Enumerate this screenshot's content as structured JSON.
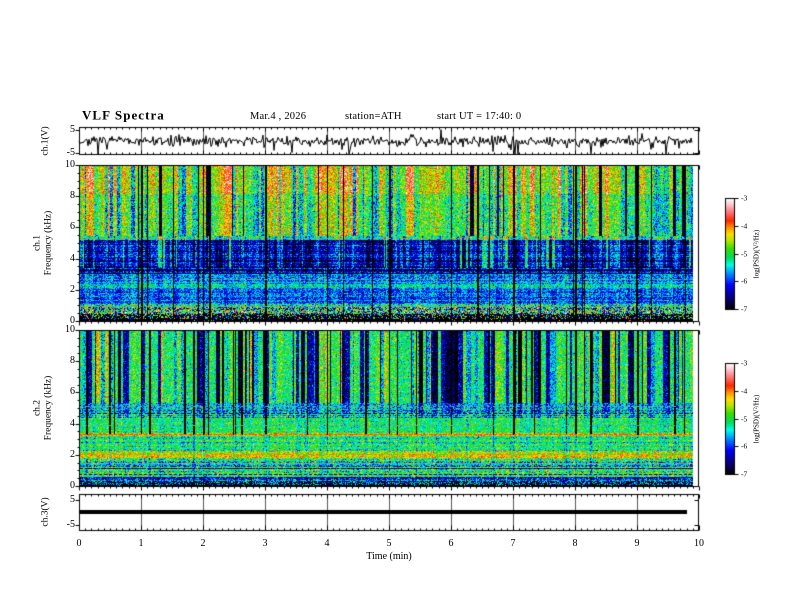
{
  "header": {
    "title": "VLF Spectra",
    "date": "Mar.4 , 2026",
    "station": "station=ATH",
    "start_ut": "start UT =  17:40: 0"
  },
  "axes": {
    "time": {
      "label": "Time (min)",
      "ticks": [
        "0",
        "1",
        "2",
        "3",
        "4",
        "5",
        "6",
        "7",
        "8",
        "9",
        "10"
      ],
      "range_min": [
        0,
        10
      ],
      "minor_tick_min": 0.1
    },
    "ch1_wave": {
      "label": "ch.1(V)",
      "ticks": [
        "5",
        "-5"
      ],
      "range_v": [
        -5,
        5
      ]
    },
    "spec1": {
      "label_line1": "ch.1",
      "label_line2": "Frequency (kHz)",
      "ticks": [
        "0",
        "2",
        "4",
        "6",
        "8",
        "10"
      ],
      "range_khz": [
        0,
        10
      ]
    },
    "spec2": {
      "label_line1": "ch.2",
      "label_line2": "Frequency (kHz)",
      "ticks": [
        "0",
        "2",
        "4",
        "6",
        "8",
        "10"
      ],
      "range_khz": [
        0,
        10
      ]
    },
    "ch3_wave": {
      "label": "ch.3(V)",
      "ticks": [
        "5",
        "-5"
      ],
      "range_v": [
        -5,
        5
      ]
    }
  },
  "colorbar": {
    "label": "log(PSD)(V²/Hz)",
    "ticks": [
      "-3",
      "-4",
      "-5",
      "-6",
      "-7"
    ],
    "range": [
      -7,
      -3
    ]
  },
  "colormap": {
    "stops": [
      [
        0,
        "#000000"
      ],
      [
        0.08,
        "#0a005a"
      ],
      [
        0.22,
        "#0000ff"
      ],
      [
        0.33,
        "#0096ff"
      ],
      [
        0.4,
        "#00ffe6"
      ],
      [
        0.47,
        "#00dc5a"
      ],
      [
        0.55,
        "#3cdc00"
      ],
      [
        0.62,
        "#b4e600"
      ],
      [
        0.68,
        "#ffdc00"
      ],
      [
        0.74,
        "#ff8c00"
      ],
      [
        0.8,
        "#ff2800"
      ],
      [
        0.87,
        "#ff6e6e"
      ],
      [
        0.94,
        "#ffbec8"
      ],
      [
        1,
        "#ffffff"
      ]
    ]
  },
  "chart_data": [
    {
      "type": "line",
      "name": "ch1_voltage_trace",
      "ylabel": "ch.1(V)",
      "ylim": [
        -5,
        5
      ],
      "xlim_min": [
        0,
        10
      ],
      "data_end_min": 9.9,
      "color": "#000000",
      "seed": 7,
      "summary": "zero-mean broadband noise, rms ~1 V, frequent impulsive sferic spikes down to -5 V and up to +4 V"
    },
    {
      "type": "heatmap",
      "name": "ch1_spectrogram",
      "xlabel": "Time (min)",
      "ylabel": "ch.1 Frequency (kHz)",
      "xlim": [
        0,
        10
      ],
      "ylim": [
        0,
        10
      ],
      "zlabel": "log(PSD)(V²/Hz)",
      "zlim": [
        -7,
        -3
      ],
      "data_end_min": 9.9,
      "seed": 42,
      "bands": [
        {
          "f": [
            8.2,
            10
          ],
          "v": -4.55,
          "sigma": 0.4
        },
        {
          "f": [
            5.45,
            8.2
          ],
          "v": -4.9,
          "sigma": 0.4
        },
        {
          "f": [
            5.2,
            5.45
          ],
          "v": -5.3,
          "sigma": 0.35
        },
        {
          "f": [
            3.4,
            5.2
          ],
          "v": -6.3,
          "sigma": 0.35,
          "row_sigma": 0.2
        },
        {
          "f": [
            2.9,
            3.4
          ],
          "v": -6.15,
          "sigma": 0.4,
          "row_sigma": 0.45
        },
        {
          "f": [
            2.4,
            2.9
          ],
          "v": -5.85,
          "sigma": 0.35,
          "row_sigma": 0.2
        },
        {
          "f": [
            2.15,
            2.4
          ],
          "v": -5.35,
          "sigma": 0.35
        },
        {
          "f": [
            1.1,
            2.15
          ],
          "v": -5.9,
          "sigma": 0.35,
          "row_sigma": 0.2
        },
        {
          "f": [
            0.95,
            1.1
          ],
          "v": -5.2,
          "sigma": 0.5
        },
        {
          "f": [
            0.45,
            0.95
          ],
          "v": -5.2,
          "sigma": 1.0,
          "row_sigma": 0.3
        },
        {
          "f": [
            0.15,
            0.45
          ],
          "speckle": {
            "p_floor": 0.6,
            "range": [
              -6.8,
              -3.6
            ]
          }
        },
        {
          "f": [
            0,
            0.15
          ],
          "speckle": {
            "p_floor": 0.96,
            "range": [
              -6.5,
              -3.5
            ]
          }
        }
      ],
      "streaks": [
        {
          "f": [
            5.45,
            10
          ],
          "ext": [
            [
              8.2,
              10,
              1.0
            ],
            [
              5.45,
              8.2,
              0.85
            ]
          ],
          "wmax": 4,
          "choices": [
            [
              0.1,
              0.9
            ],
            [
              0.28,
              0.45
            ],
            [
              0.52,
              0.05
            ],
            [
              0.72,
              -0.3
            ],
            [
              0.86,
              -0.65
            ],
            [
              0.94,
              -1.1
            ],
            [
              1,
              -2.4
            ]
          ]
        },
        {
          "f": [
            3.4,
            5.45
          ],
          "ext": [
            [
              3.4,
              5.45,
              1
            ]
          ],
          "wmax": 3,
          "choices": [
            [
              0.08,
              1.15
            ],
            [
              0.25,
              0.5
            ],
            [
              0.6,
              0.1
            ],
            [
              0.85,
              -0.15
            ],
            [
              1,
              -0.55
            ]
          ]
        },
        {
          "f": [
            0,
            3.4
          ],
          "ext": [
            [
              0,
              3.4,
              1
            ]
          ],
          "wmax": 3,
          "choices": [
            [
              0.3,
              0.15
            ],
            [
              0.7,
              0
            ],
            [
              1,
              -0.2
            ]
          ]
        }
      ],
      "lines": [
        {
          "f": 5.3,
          "gray": true,
          "dash": [
            4,
            3
          ]
        },
        {
          "f": 2.72,
          "gray": true,
          "dash": [
            2,
            4
          ]
        },
        {
          "f": 0.98,
          "gray": true,
          "dash": [
            3,
            3
          ]
        }
      ],
      "black_columns": {
        "at_minutes": [
          1,
          2,
          3,
          4,
          5,
          6,
          7,
          8,
          9
        ],
        "random_count": 16,
        "full_height": true
      }
    },
    {
      "type": "heatmap",
      "name": "ch2_spectrogram",
      "xlabel": "Time (min)",
      "ylabel": "ch.2 Frequency (kHz)",
      "xlim": [
        0,
        10
      ],
      "ylim": [
        0,
        10
      ],
      "zlabel": "log(PSD)(V²/Hz)",
      "zlim": [
        -7,
        -3
      ],
      "data_end_min": 9.9,
      "seed": 1337,
      "bands": [
        {
          "f": [
            5.35,
            10
          ],
          "v": -5.15,
          "sigma": 0.35
        },
        {
          "f": [
            5.0,
            5.35
          ],
          "v": -5.5,
          "sigma": 0.4
        },
        {
          "f": [
            4.4,
            5.0
          ],
          "v": -5.3,
          "sigma": 0.45,
          "row_sigma": 0.3
        },
        {
          "f": [
            3.45,
            4.4
          ],
          "v": -5.05,
          "sigma": 0.3,
          "row_sigma": 0.15
        },
        {
          "f": [
            3.25,
            3.45
          ],
          "v": -4.3,
          "sigma": 0.4
        },
        {
          "f": [
            2.25,
            3.25
          ],
          "v": -5.2,
          "sigma": 0.35,
          "row_sigma": 0.2
        },
        {
          "f": [
            1.8,
            2.25
          ],
          "v": -4.45,
          "sigma": 0.35,
          "row_sigma": 0.2
        },
        {
          "f": [
            1.35,
            1.8
          ],
          "v": -5.1,
          "sigma": 0.45,
          "row_sigma": 0.3
        },
        {
          "f": [
            0.35,
            1.35
          ],
          "v": -5.45,
          "sigma": 0.45,
          "row_sigma": 0.55
        },
        {
          "f": [
            0.12,
            0.35
          ],
          "speckle": {
            "p_floor": 0.5,
            "range": [
              -6.3,
              -5.0
            ]
          }
        },
        {
          "f": [
            0,
            0.12
          ],
          "speckle": {
            "p_floor": 0.95,
            "range": [
              -6.5,
              -4.0
            ]
          }
        }
      ],
      "streaks": [
        {
          "f": [
            4.4,
            10
          ],
          "ext": [
            [
              5.35,
              10,
              1.0
            ],
            [
              4.4,
              5.35,
              0.3
            ]
          ],
          "wmax": 4,
          "choices": [
            [
              0.05,
              0.8
            ],
            [
              0.18,
              0.35
            ],
            [
              0.45,
              0.05
            ],
            [
              0.6,
              -0.45
            ],
            [
              0.82,
              -1.25
            ],
            [
              0.93,
              -1.7
            ],
            [
              1,
              -2.5
            ]
          ]
        },
        {
          "f": [
            0,
            4.4
          ],
          "ext": [
            [
              0,
              4.4,
              1
            ]
          ],
          "wmax": 3,
          "choices": [
            [
              0.3,
              0.12
            ],
            [
              0.7,
              0
            ],
            [
              1,
              -0.18
            ]
          ]
        }
      ],
      "lines": [
        {
          "f": 5.15,
          "gray": true,
          "dash": [
            3,
            3
          ]
        },
        {
          "f": 4.65,
          "v": -6.6,
          "dash": [
            4,
            2
          ]
        },
        {
          "f": 3.9,
          "gray": true,
          "dash": [
            2,
            4
          ]
        },
        {
          "f": 3.35,
          "v": -3.9,
          "dash": [
            3,
            2
          ]
        },
        {
          "f": 2.05,
          "v": -4.0,
          "dash": [
            4,
            3
          ]
        },
        {
          "f": 1.5,
          "gray": true,
          "dash": [
            2,
            2
          ]
        },
        {
          "f": 0.75,
          "v": -6.4,
          "dash": [
            3,
            2
          ]
        }
      ],
      "black_columns": {
        "at_minutes": [
          1,
          2,
          3,
          4,
          5,
          6,
          7,
          8,
          9
        ],
        "random_count": 20,
        "full_height": false,
        "black_above_khz": 3.3,
        "dim_below": 0.45
      }
    },
    {
      "type": "line",
      "name": "ch3_voltage_trace",
      "ylabel": "ch.3(V)",
      "ylim": [
        -5,
        5
      ],
      "data_end_min": 9.9,
      "color": "#000000",
      "summary": "constant 0 V flat thick line (channel inactive)"
    }
  ]
}
